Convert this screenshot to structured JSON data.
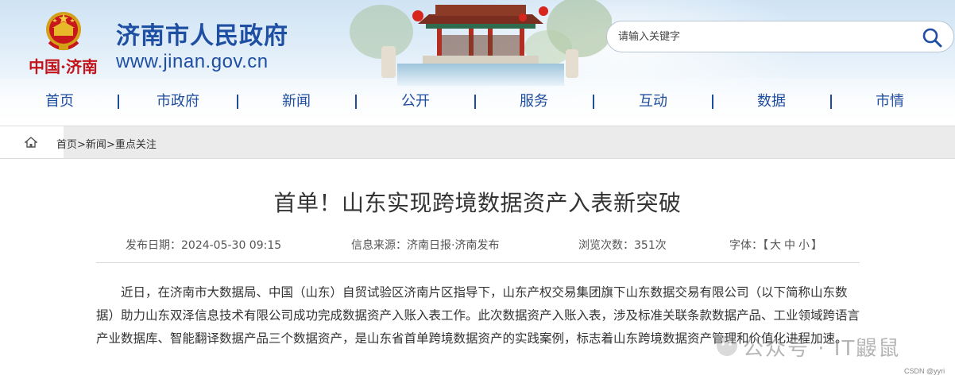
{
  "site": {
    "title": "济南市人民政府",
    "url": "www.jinan.gov.cn",
    "seal_text": "中国·济南"
  },
  "search": {
    "placeholder": "请输入关键字",
    "icon": "search-icon"
  },
  "nav": {
    "items": [
      {
        "label": "首页"
      },
      {
        "label": "市政府"
      },
      {
        "label": "新闻"
      },
      {
        "label": "公开"
      },
      {
        "label": "服务"
      },
      {
        "label": "互动"
      },
      {
        "label": "数据"
      },
      {
        "label": "市情"
      }
    ]
  },
  "breadcrumb": {
    "home_icon": "home-icon",
    "items": [
      "首页",
      "新闻",
      "重点关注"
    ],
    "separator": ">"
  },
  "article": {
    "title": "首单！山东实现跨境数据资产入表新突破",
    "meta": {
      "publish_label": "发布日期：",
      "publish_date": "2024-05-30 09:15",
      "source_label": "信息来源：",
      "source": "济南日报·济南发布",
      "views_label": "浏览次数：",
      "views": "351次",
      "font_label": "字体：",
      "font_open": "【",
      "font_large": "大",
      "font_medium": "中",
      "font_small": "小",
      "font_close": "】"
    },
    "paragraph": "近日，在济南市大数据局、中国（山东）自贸试验区济南片区指导下，山东产权交易集团旗下山东数据交易有限公司（以下简称山东数据）助力山东双泽信息技术有限公司成功完成数据资产入账入表工作。此次数据资产入账入表，涉及标准关联条款数据产品、工业领域跨语言产业数据库、智能翻译数据产品三个数据资产，是山东省首单跨境数据资产的实践案例，标志着山东跨境数据资产管理和价值化进程加速。"
  },
  "watermark": {
    "text": "公众号 · IT鼹鼠",
    "csdn": "CSDN @yyri"
  },
  "colors": {
    "brand_blue": "#1f4fa3",
    "seal_red": "#c2151b",
    "crumb_bg": "#ebebeb"
  }
}
